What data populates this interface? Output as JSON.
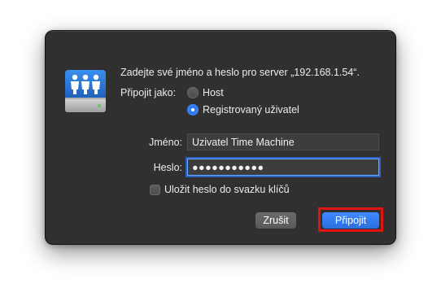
{
  "dialog": {
    "prompt": "Zadejte své jméno a heslo pro server „192.168.1.54“.",
    "connect_as_label": "Připojit jako:",
    "options": [
      {
        "label": "Host",
        "selected": false
      },
      {
        "label": "Registrovaný uživatel",
        "selected": true
      }
    ],
    "name_label": "Jméno:",
    "name_value": "Uzivatel Time Machine",
    "password_label": "Heslo:",
    "password_value": "●●●●●●●●●●●",
    "keychain_label": "Uložit heslo do svazku klíčů",
    "keychain_checked": false,
    "cancel_button": "Zrušit",
    "connect_button": "Připojit",
    "server_icon": "network-server-icon",
    "colors": {
      "dialog_bg": "#303030",
      "accent": "#2f7cf6",
      "highlight": "#e01414"
    }
  }
}
